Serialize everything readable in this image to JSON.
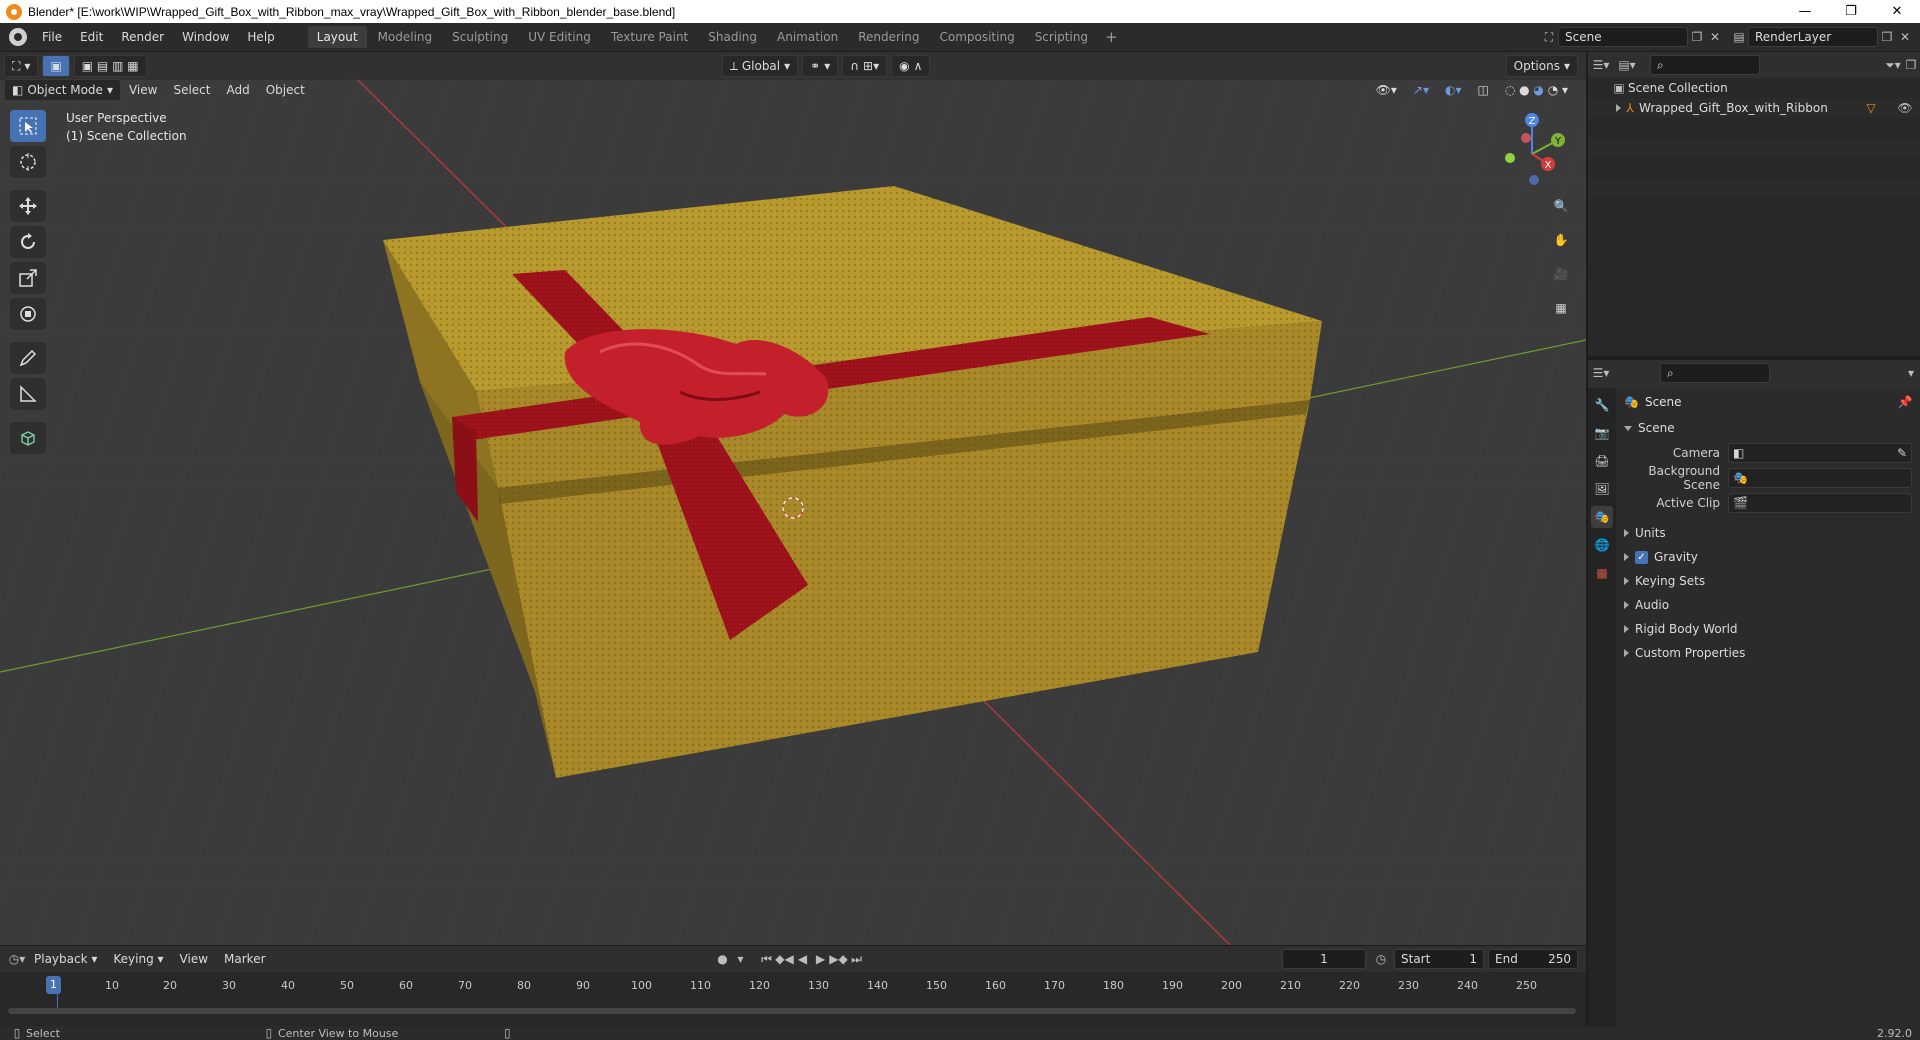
{
  "window": {
    "title": "Blender* [E:\\work\\WIP\\Wrapped_Gift_Box_with_Ribbon_max_vray\\Wrapped_Gift_Box_with_Ribbon_blender_base.blend]",
    "minimize": "—",
    "restore": "❐",
    "close": "✕"
  },
  "menus": [
    "File",
    "Edit",
    "Render",
    "Window",
    "Help"
  ],
  "workspaces": [
    "Layout",
    "Modeling",
    "Sculpting",
    "UV Editing",
    "Texture Paint",
    "Shading",
    "Animation",
    "Rendering",
    "Compositing",
    "Scripting"
  ],
  "workspace_add": "+",
  "scene_name": "Scene",
  "render_layer": "RenderLayer",
  "viewport": {
    "mode": "Object Mode",
    "menus": [
      "View",
      "Select",
      "Add",
      "Object"
    ],
    "orientation": "Global",
    "options": "Options",
    "info_line1": "User Perspective",
    "info_line2": "(1) Scene Collection"
  },
  "gizmo": {
    "x": "X",
    "y": "Y",
    "z": "Z"
  },
  "outliner": {
    "root": "Scene Collection",
    "item": "Wrapped_Gift_Box_with_Ribbon"
  },
  "properties": {
    "context_title": "Scene",
    "panel": "Scene",
    "fields": [
      {
        "label": "Camera"
      },
      {
        "label": "Background Scene"
      },
      {
        "label": "Active Clip"
      }
    ],
    "sections": [
      "Units",
      "Gravity",
      "Keying Sets",
      "Audio",
      "Rigid Body World",
      "Custom Properties"
    ]
  },
  "timeline": {
    "menus": [
      "Playback",
      "Keying",
      "View",
      "Marker"
    ],
    "current_frame": "1",
    "start_label": "Start",
    "start": "1",
    "end_label": "End",
    "end": "250",
    "ruler": [
      "1",
      "10",
      "20",
      "30",
      "40",
      "50",
      "60",
      "70",
      "80",
      "90",
      "100",
      "110",
      "120",
      "130",
      "140",
      "150",
      "160",
      "170",
      "180",
      "190",
      "200",
      "210",
      "220",
      "230",
      "240",
      "250"
    ]
  },
  "status": {
    "left": "Select",
    "middle": "Center View to Mouse",
    "version": "2.92.0"
  },
  "colors": {
    "accent": "#4772b3",
    "box": "#b89a2e",
    "ribbon": "#a0121c",
    "axis_x": "#d03b3b",
    "axis_y": "#7fb234"
  }
}
